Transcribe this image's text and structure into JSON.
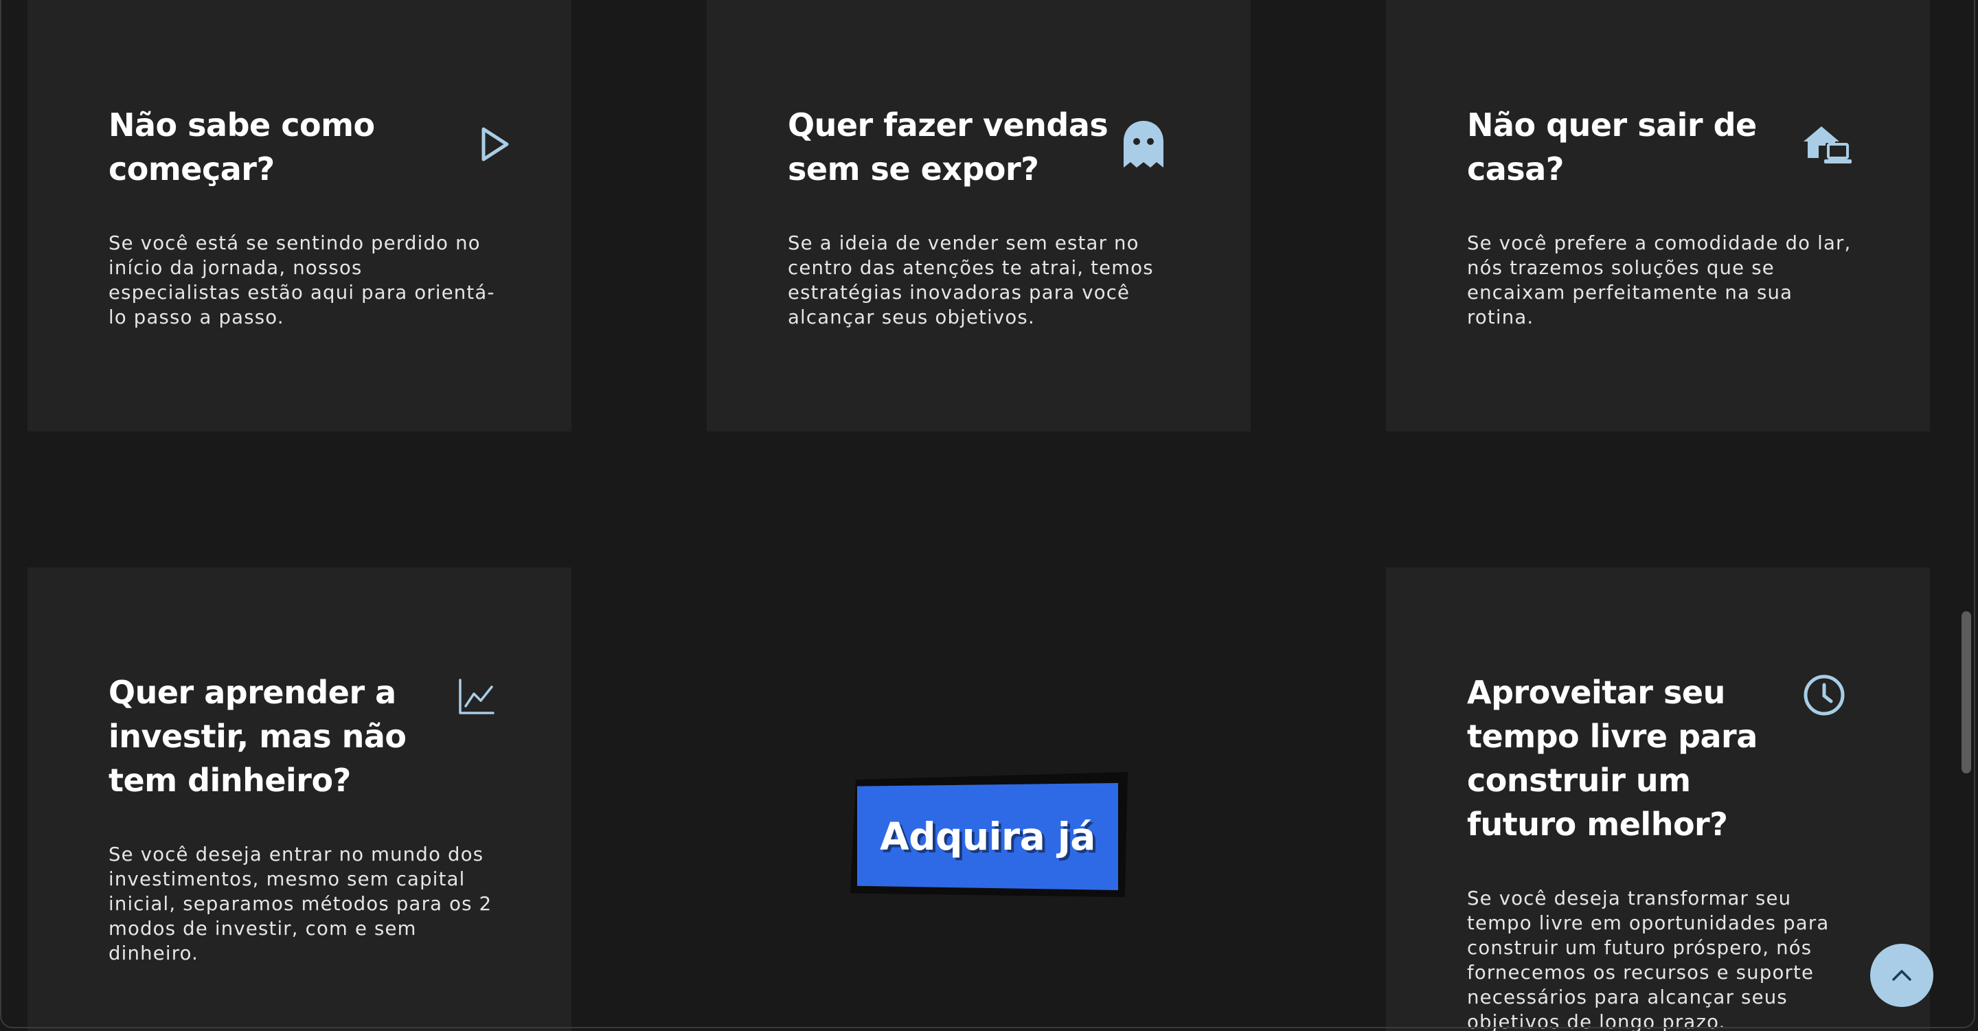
{
  "colors": {
    "page_background": "#191919",
    "card_background": "#232323",
    "icon_accent": "#a9cde6",
    "cta_background": "#2f6ae6",
    "text_primary": "#ffffff",
    "text_secondary": "#e6e6e6"
  },
  "cards": [
    {
      "title": "Não sabe como começar?",
      "text": "Se você está se sentindo perdido no início da jornada, nossos especialistas estão aqui para orientá-lo passo a passo.",
      "icon": "play-icon"
    },
    {
      "title": "Quer fazer vendas sem se expor?",
      "text": "Se a ideia de vender sem estar no centro das atenções te atrai, temos estratégias inovadoras para você alcançar seus objetivos.",
      "icon": "ghost-icon"
    },
    {
      "title": "Não quer sair de casa?",
      "text": "Se você prefere a comodidade do lar, nós trazemos soluções que se encaixam perfeitamente na sua rotina.",
      "icon": "house-laptop-icon"
    },
    {
      "title": "Quer aprender a investir, mas não tem dinheiro?",
      "text": "Se você deseja entrar no mundo dos investimentos, mesmo sem capital inicial, separamos métodos para os 2 modos de investir, com e sem dinheiro.",
      "icon": "line-chart-icon"
    },
    {
      "title": "Aproveitar seu tempo livre para construir um futuro melhor?",
      "text": "Se você deseja transformar seu tempo livre em oportunidades para construir um futuro próspero, nós fornecemos os recursos e suporte necessários para alcançar seus objetivos de longo prazo.",
      "icon": "clock-icon"
    }
  ],
  "cta": {
    "label": "Adquira já"
  },
  "back_to_top": {
    "icon": "chevron-up-icon"
  }
}
